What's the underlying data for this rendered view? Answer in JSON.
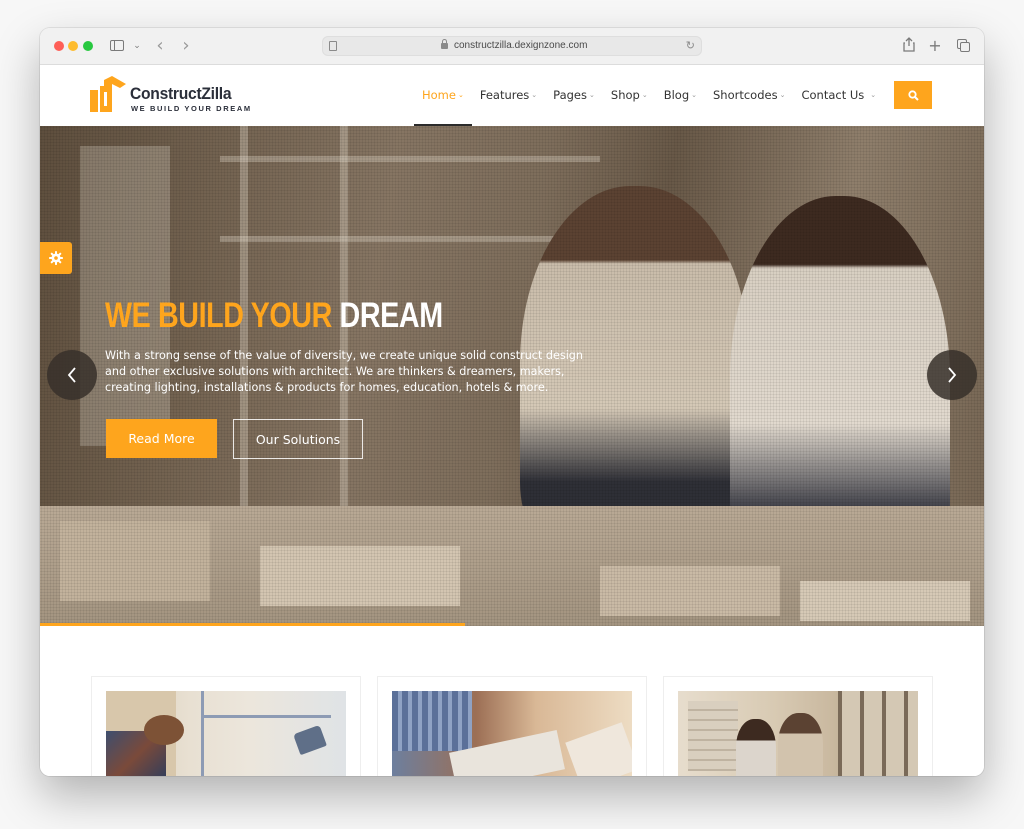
{
  "browser": {
    "url": "constructzilla.dexignzone.com",
    "icons": {
      "sidebar": "sidebar-icon",
      "back": "chevron-left-icon",
      "forward": "chevron-right-icon",
      "reader": "reader-icon",
      "lock": "lock-icon",
      "reload": "reload-icon",
      "share": "share-icon",
      "new_tab": "plus-icon",
      "tab_overview": "tabs-icon"
    },
    "glyphs": {
      "dropdown": "⌄",
      "back": "‹",
      "forward": "›",
      "reload": "↻",
      "share": "⇪",
      "new_tab": "+"
    }
  },
  "site": {
    "brand": {
      "name": "ConstructZilla",
      "tagline": "WE BUILD YOUR DREAM",
      "accent_color": "#fea51d",
      "dark_color": "#2b2f3a"
    },
    "nav": {
      "caret": "⌄",
      "items": [
        {
          "label": "Home",
          "active": true
        },
        {
          "label": "Features",
          "active": false
        },
        {
          "label": "Pages",
          "active": false
        },
        {
          "label": "Shop",
          "active": false
        },
        {
          "label": "Blog",
          "active": false
        },
        {
          "label": "Shortcodes",
          "active": false
        },
        {
          "label": "Contact Us",
          "active": false
        }
      ],
      "search_icon": "search-icon"
    },
    "hero": {
      "title_accent": "WE BUILD YOUR",
      "title_plain": "DREAM",
      "description": "With a strong sense of the value of diversity, we create unique solid construct design and other exclusive solutions with architect. We are thinkers & dreamers, makers, creating lighting, installations & products for homes, education, hotels & more.",
      "primary_button": "Read More",
      "secondary_button": "Our Solutions",
      "slide_progress_percent": 45
    },
    "cards": [
      {
        "image": "architect at desk with lamp"
      },
      {
        "image": "team reviewing charts on table"
      },
      {
        "image": "two colleagues studying plans"
      }
    ]
  }
}
